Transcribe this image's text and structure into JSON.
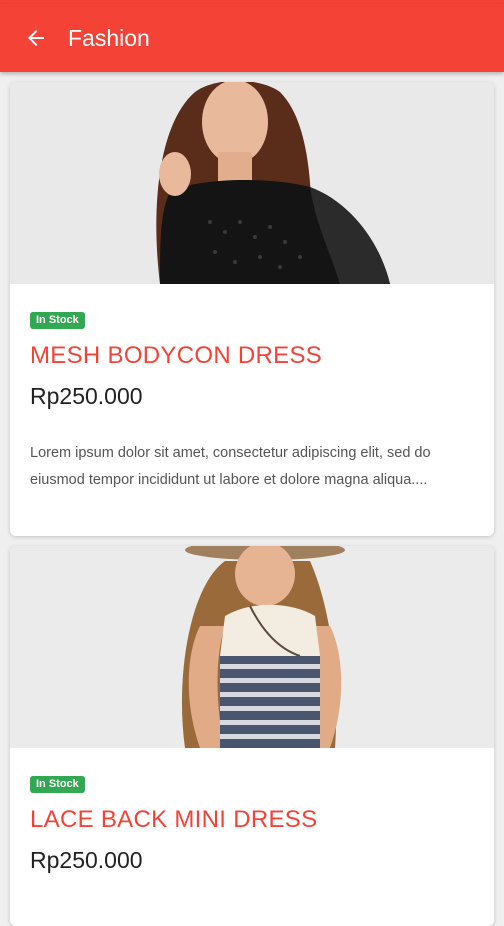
{
  "appbar": {
    "title": "Fashion",
    "back_icon": "arrow-left-icon",
    "color": "#f44336"
  },
  "products": [
    {
      "badge": "In Stock",
      "name": "MESH BODYCON DRESS",
      "price": "Rp250.000",
      "description": "Lorem ipsum dolor sit amet, consectetur adipiscing elit, sed do eiusmod tempor incididunt ut labore et dolore magna aliqua...."
    },
    {
      "badge": "In Stock",
      "name": "LACE BACK MINI DRESS",
      "price": "Rp250.000"
    }
  ],
  "colors": {
    "accent": "#f44336",
    "badge": "#33a852"
  }
}
